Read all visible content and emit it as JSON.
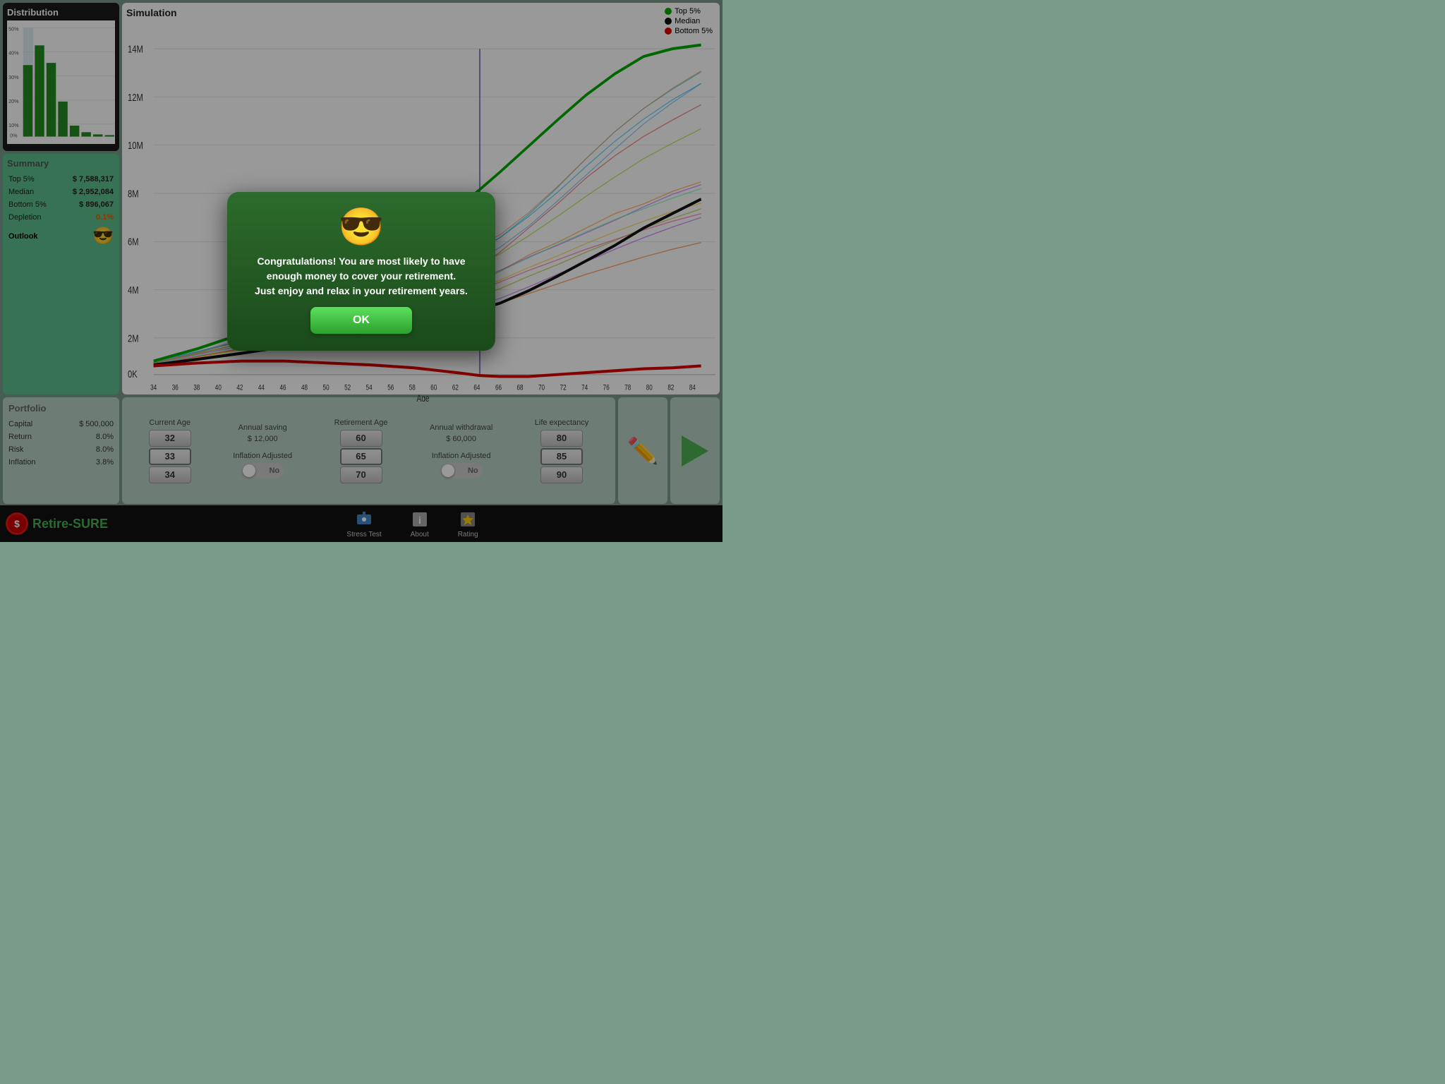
{
  "app": {
    "name": "Retire-SURE"
  },
  "distribution": {
    "title": "Distribution",
    "y_labels": [
      "50%",
      "40%",
      "30%",
      "20%",
      "10%",
      "0%"
    ],
    "bars": [
      33,
      42,
      34,
      16,
      5,
      2,
      1,
      0.5,
      0.3
    ]
  },
  "summary": {
    "title": "Summary",
    "rows": [
      {
        "label": "Top 5%",
        "value": "$ 7,588,317"
      },
      {
        "label": "Median",
        "value": "$ 2,952,084"
      },
      {
        "label": "Bottom 5%",
        "value": "$ 896,067"
      },
      {
        "label": "Depletion",
        "value": "0.1%",
        "orange": true
      },
      {
        "label": "Outlook",
        "value": ""
      }
    ]
  },
  "simulation": {
    "title": "Simulation",
    "legend": [
      {
        "label": "Top 5%",
        "color": "#00aa00"
      },
      {
        "label": "Median",
        "color": "#111111"
      },
      {
        "label": "Bottom 5%",
        "color": "#dd0000"
      }
    ],
    "x_axis_label": "Age",
    "x_labels": [
      "34",
      "36",
      "38",
      "40",
      "42",
      "44",
      "46",
      "48",
      "50",
      "52",
      "54",
      "56",
      "58",
      "60",
      "62",
      "64",
      "66",
      "68",
      "70",
      "72",
      "74",
      "76",
      "78",
      "80",
      "82",
      "84"
    ],
    "y_labels": [
      "14M",
      "12M",
      "10M",
      "",
      "8M",
      "6M",
      "4M",
      "2M",
      "0K"
    ]
  },
  "portfolio": {
    "title": "Portfolio",
    "rows": [
      {
        "label": "Capital",
        "value": "$ 500,000"
      },
      {
        "label": "Return",
        "value": "8.0%"
      },
      {
        "label": "Risk",
        "value": "8.0%"
      },
      {
        "label": "Inflation",
        "value": "3.8%"
      }
    ]
  },
  "controls": {
    "current_age": {
      "label": "Current Age",
      "values": [
        "32",
        "33",
        "34"
      ]
    },
    "annual_saving": {
      "label": "Annual saving",
      "value": "$ 12,000",
      "inflation_label": "Inflation Adjusted",
      "toggle_text": "No"
    },
    "retirement_age": {
      "label": "Retirement Age",
      "values": [
        "60",
        "65",
        "70"
      ]
    },
    "annual_withdrawal": {
      "label": "Annual withdrawal",
      "value": "$ 60,000",
      "inflation_label": "Inflation Adjusted",
      "toggle_text": "No"
    },
    "life_expectancy": {
      "label": "Life expectancy",
      "values": [
        "80",
        "85",
        "90"
      ]
    }
  },
  "modal": {
    "emoji": "😎",
    "text": "Congratulations!  You are most likely to have enough money to cover your retirement.\nJust enjoy and relax in your retirement years.",
    "ok_label": "OK"
  },
  "taskbar": {
    "items": [
      {
        "label": "Stress Test",
        "icon": "stress"
      },
      {
        "label": "About",
        "icon": "info"
      },
      {
        "label": "Rating",
        "icon": "star"
      }
    ]
  }
}
